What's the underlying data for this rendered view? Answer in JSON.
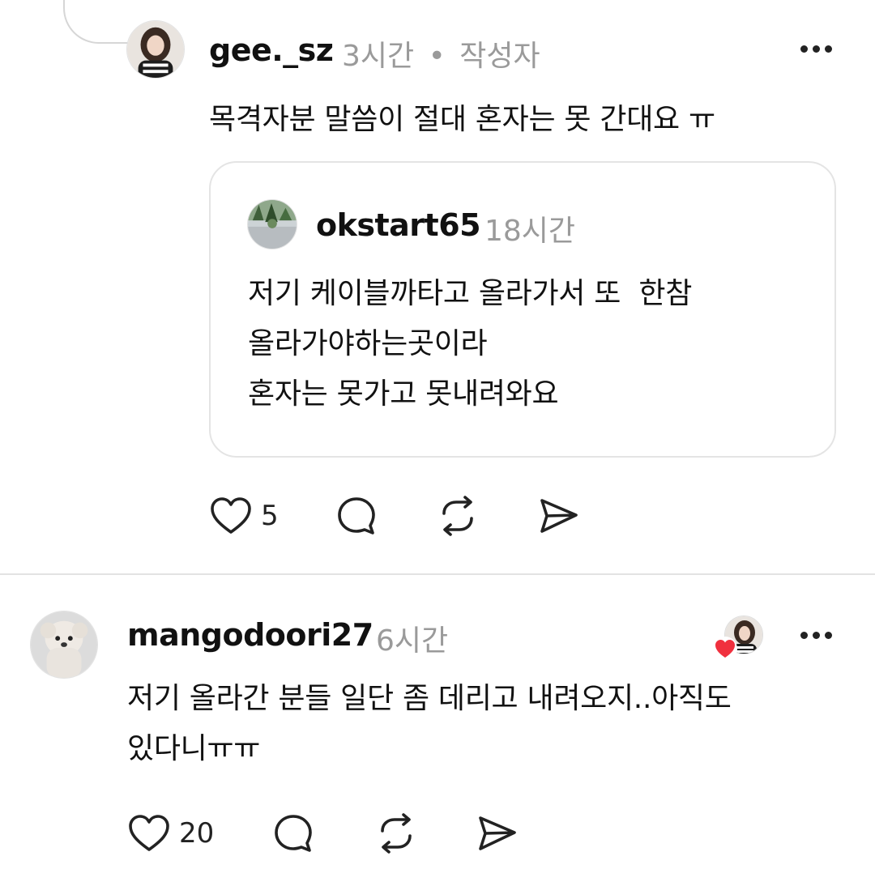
{
  "reply": {
    "username": "gee._sz",
    "time": "3시간",
    "separator": "•",
    "author_tag": "작성자",
    "text": "목격자분 말씀이 절대 혼자는 못 간대요 ㅠ",
    "quoted": {
      "username": "okstart65",
      "time": "18시간",
      "text": "저기 케이블까타고 올라가서 또  한참\n올라가야하는곳이라\n혼자는 못가고 못내려와요"
    },
    "like_count": "5"
  },
  "comment": {
    "username": "mangodoori27",
    "time": "6시간",
    "text": "저기 올라간 분들 일단 좀 데리고 내려오지..아직도\n있다니ㅠㅠ",
    "like_count": "20"
  },
  "colors": {
    "text": "#111111",
    "muted": "#9a9a9a",
    "divider": "#e3e3e3",
    "heart_badge": "#f0303e"
  },
  "icons": [
    "heart-icon",
    "comment-icon",
    "repost-icon",
    "share-icon",
    "more-icon"
  ]
}
